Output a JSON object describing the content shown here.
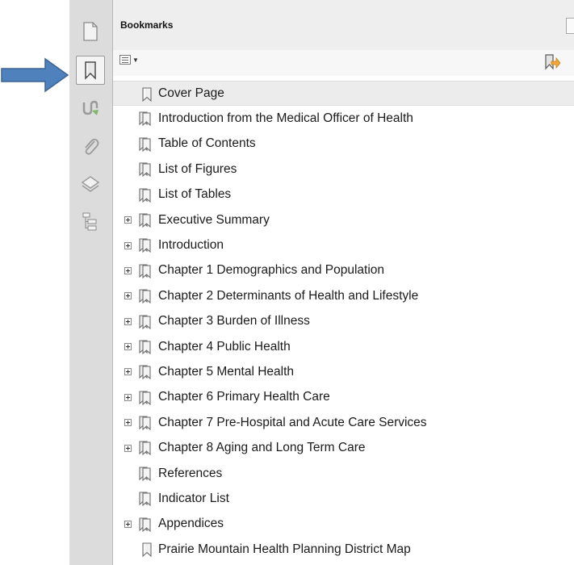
{
  "panel": {
    "title": "Bookmarks"
  },
  "bookmarks": [
    {
      "label": "Cover Page",
      "expandable": false,
      "icon": "bookmark-single-icon",
      "selected": true
    },
    {
      "label": "Introduction from the Medical Officer of Health",
      "expandable": false,
      "icon": "bookmark-icon"
    },
    {
      "label": "Table of Contents",
      "expandable": false,
      "icon": "bookmark-icon"
    },
    {
      "label": "List of Figures",
      "expandable": false,
      "icon": "bookmark-icon"
    },
    {
      "label": "List of Tables",
      "expandable": false,
      "icon": "bookmark-icon"
    },
    {
      "label": "Executive Summary",
      "expandable": true,
      "icon": "bookmark-icon"
    },
    {
      "label": "Introduction",
      "expandable": true,
      "icon": "bookmark-icon"
    },
    {
      "label": "Chapter 1 Demographics and Population",
      "expandable": true,
      "icon": "bookmark-icon"
    },
    {
      "label": "Chapter 2 Determinants of Health and Lifestyle",
      "expandable": true,
      "icon": "bookmark-icon"
    },
    {
      "label": "Chapter 3 Burden of Illness",
      "expandable": true,
      "icon": "bookmark-icon"
    },
    {
      "label": "Chapter 4 Public Health",
      "expandable": true,
      "icon": "bookmark-icon"
    },
    {
      "label": "Chapter 5 Mental Health",
      "expandable": true,
      "icon": "bookmark-icon"
    },
    {
      "label": "Chapter 6 Primary Health Care",
      "expandable": true,
      "icon": "bookmark-icon"
    },
    {
      "label": "Chapter 7 Pre-Hospital and Acute Care Services",
      "expandable": true,
      "icon": "bookmark-icon"
    },
    {
      "label": "Chapter 8 Aging and Long Term Care",
      "expandable": true,
      "icon": "bookmark-icon"
    },
    {
      "label": "References",
      "expandable": false,
      "icon": "bookmark-icon"
    },
    {
      "label": "Indicator List",
      "expandable": false,
      "icon": "bookmark-icon"
    },
    {
      "label": "Appendices",
      "expandable": true,
      "icon": "bookmark-icon"
    },
    {
      "label": "Prairie Mountain Health Planning District Map",
      "expandable": false,
      "icon": "bookmark-single-icon"
    }
  ],
  "colors": {
    "arrow": "#4f81bd",
    "bookmark_icon": "#7a7a7a",
    "sidebar": "#dcdcdc"
  },
  "sidebar_icons": [
    "page-thumbnails-icon",
    "bookmarks-icon",
    "signatures-icon",
    "attachments-icon",
    "layers-icon",
    "tags-icon"
  ]
}
